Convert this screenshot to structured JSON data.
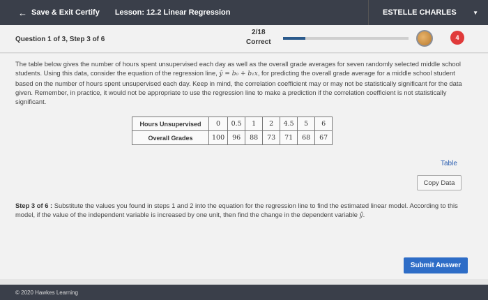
{
  "topbar": {
    "save_exit": "Save & Exit Certify",
    "lesson": "Lesson: 12.2 Linear Regression",
    "user": "ESTELLE CHARLES"
  },
  "question_header": {
    "label": "Question 1 of 3, Step 3 of 6",
    "score": "2/18",
    "score_status": "Correct",
    "progress_fraction": 0.18,
    "badge_count": "4"
  },
  "problem": {
    "text_1": "The table below gives the number of hours spent unsupervised each day as well as the overall grade averages for seven randomly selected middle school students. Using this data, consider the equation of the regression line, ",
    "equation": "ŷ = b₀ + b₁x",
    "text_2": ", for predicting the overall grade average for a middle school student based on the number of hours spent unsupervised each day. Keep in mind, the correlation coefficient may or may not be statistically significant for the data given. Remember, in practice, it would not be appropriate to use the regression line to make a prediction if the correlation coefficient is not statistically significant."
  },
  "data_table": {
    "row1_label": "Hours Unsupervised",
    "row1_values": [
      "0",
      "0.5",
      "1",
      "2",
      "4.5",
      "5",
      "6"
    ],
    "row2_label": "Overall Grades",
    "row2_values": [
      "100",
      "96",
      "88",
      "73",
      "71",
      "68",
      "67"
    ]
  },
  "table_link": "Table",
  "copy_data": "Copy Data",
  "step": {
    "label": "Step 3 of 6 :",
    "text": " Substitute the values you found in steps 1 and 2 into the equation for the regression line to find the estimated linear model. According to this model, if the value of the independent variable is increased by one unit, then find the change in the dependent variable ",
    "yhat": "ŷ",
    "end": "."
  },
  "submit": "Submit Answer",
  "footer": "© 2020 Hawkes Learning"
}
